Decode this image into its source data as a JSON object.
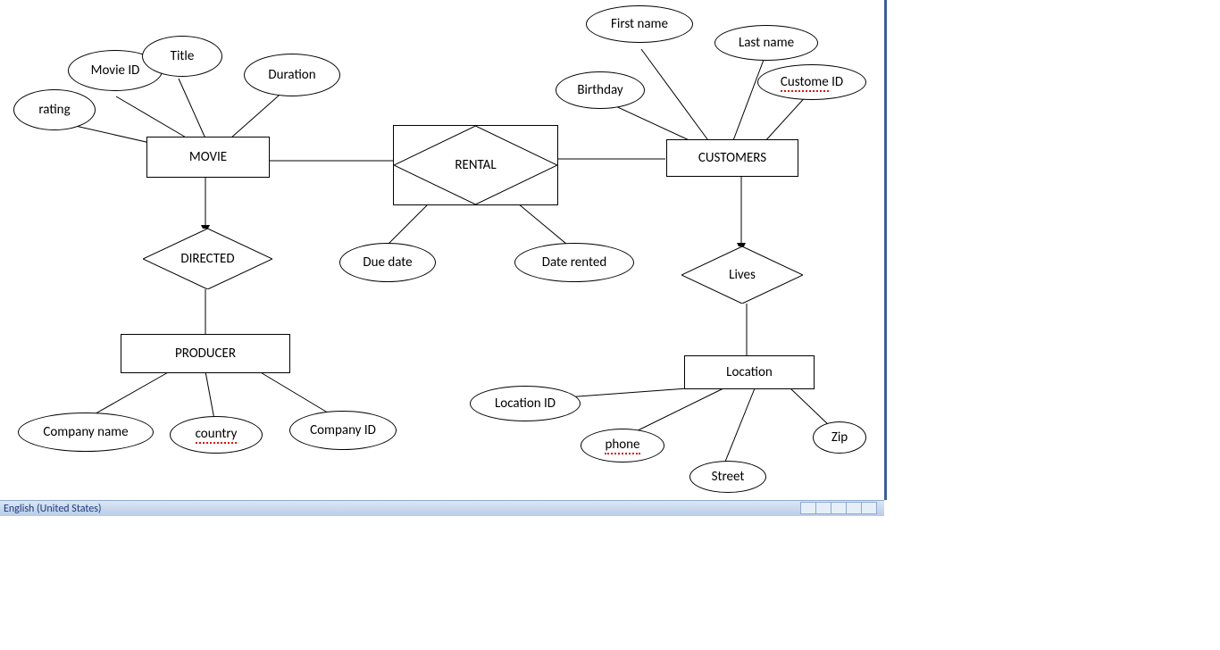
{
  "entities": {
    "movie": "MOVIE",
    "producer": "PRODUCER",
    "customers": "CUSTOMERS",
    "location": "Location"
  },
  "relationships": {
    "rental": "RENTAL",
    "directed": "DIRECTED",
    "lives": "Lives"
  },
  "attributes": {
    "movie_id": "Movie ID",
    "title": "Title",
    "duration": "Duration",
    "rating": "rating",
    "due_date": "Due date",
    "date_rented": "Date rented",
    "first_name": "First name",
    "last_name": "Last name",
    "birthday": "Birthday",
    "custome_id": "Custome ID",
    "company_name": "Company name",
    "country": "country",
    "company_id": "Company ID",
    "location_id": "Location ID",
    "phone": "phone",
    "street": "Street",
    "zip": "Zip"
  },
  "statusbar": {
    "language": "English (United States)"
  }
}
